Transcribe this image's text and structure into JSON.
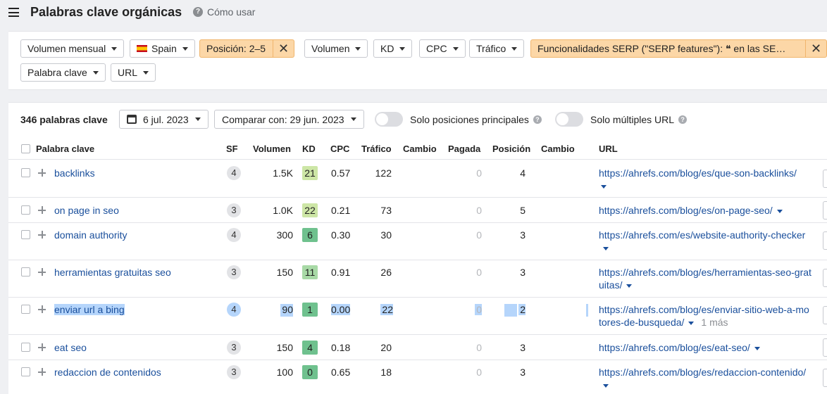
{
  "header": {
    "title": "Palabras clave orgánicas",
    "help_label": "Cómo usar"
  },
  "filters": {
    "volumen_mensual": "Volumen mensual",
    "country": "Spain",
    "posicion": "Posición: 2–5",
    "volumen": "Volumen",
    "kd": "KD",
    "cpc": "CPC",
    "trafico": "Tráfico",
    "serp": "Funcionalidades SERP (\"SERP features\"): ❝ en las SE…",
    "palabra_clave": "Palabra clave",
    "url": "URL"
  },
  "toolbar": {
    "count": "346 palabras clave",
    "date": "6 jul. 2023",
    "compare": "Comparar con: 29 jun. 2023",
    "toggle1": "Solo posiciones principales",
    "toggle2": "Solo múltiples URL"
  },
  "columns": {
    "keyword": "Palabra clave",
    "sf": "SF",
    "volume": "Volumen",
    "kd": "KD",
    "cpc": "CPC",
    "traffic": "Tráfico",
    "change": "Cambio",
    "paid": "Pagada",
    "position": "Posición",
    "change2": "Cambio",
    "url": "URL"
  },
  "rows": [
    {
      "keyword": "backlinks",
      "sf": "4",
      "volume": "1.5K",
      "kd": "21",
      "kd_color": "#cde6a6",
      "cpc": "0.57",
      "traffic": "122",
      "paid": "0",
      "position": "4",
      "url": "https://ahrefs.com/blog/es/que-son-backlinks/",
      "more": ""
    },
    {
      "keyword": "on page in seo",
      "sf": "3",
      "volume": "1.0K",
      "kd": "22",
      "kd_color": "#cde6a6",
      "cpc": "0.21",
      "traffic": "73",
      "paid": "0",
      "position": "5",
      "url": "https://ahrefs.com/blog/es/on-page-seo/",
      "more": ""
    },
    {
      "keyword": "domain authority",
      "sf": "4",
      "volume": "300",
      "kd": "6",
      "kd_color": "#6fc18e",
      "cpc": "0.30",
      "traffic": "30",
      "paid": "0",
      "position": "3",
      "url": "https://ahrefs.com/es/website-authority-checker",
      "more": ""
    },
    {
      "keyword": "herramientas gratuitas seo",
      "sf": "3",
      "volume": "150",
      "kd": "11",
      "kd_color": "#a8d9a6",
      "cpc": "0.91",
      "traffic": "26",
      "paid": "0",
      "position": "3",
      "url": "https://ahrefs.com/blog/es/herramientas-seo-gratuitas/",
      "more": ""
    },
    {
      "keyword": "enviar url a bing",
      "sf": "4",
      "volume": "90",
      "kd": "1",
      "kd_color": "#6fc18e",
      "cpc": "0.00",
      "traffic": "22",
      "paid": "0",
      "position": "2",
      "url": "https://ahrefs.com/blog/es/enviar-sitio-web-a-motores-de-busqueda/",
      "more": "1 más"
    },
    {
      "keyword": "eat seo",
      "sf": "3",
      "volume": "150",
      "kd": "4",
      "kd_color": "#6fc18e",
      "cpc": "0.18",
      "traffic": "20",
      "paid": "0",
      "position": "3",
      "url": "https://ahrefs.com/blog/es/eat-seo/",
      "more": ""
    },
    {
      "keyword": "redaccion de contenidos",
      "sf": "3",
      "volume": "100",
      "kd": "0",
      "kd_color": "#6fc18e",
      "cpc": "0.65",
      "traffic": "18",
      "paid": "0",
      "position": "3",
      "url": "https://ahrefs.com/blog/es/redaccion-contenido/",
      "more": ""
    }
  ],
  "colors": {
    "link": "#1a4f9c",
    "active_filter": "#fcd7a7",
    "selection": "#b5d5fb"
  }
}
